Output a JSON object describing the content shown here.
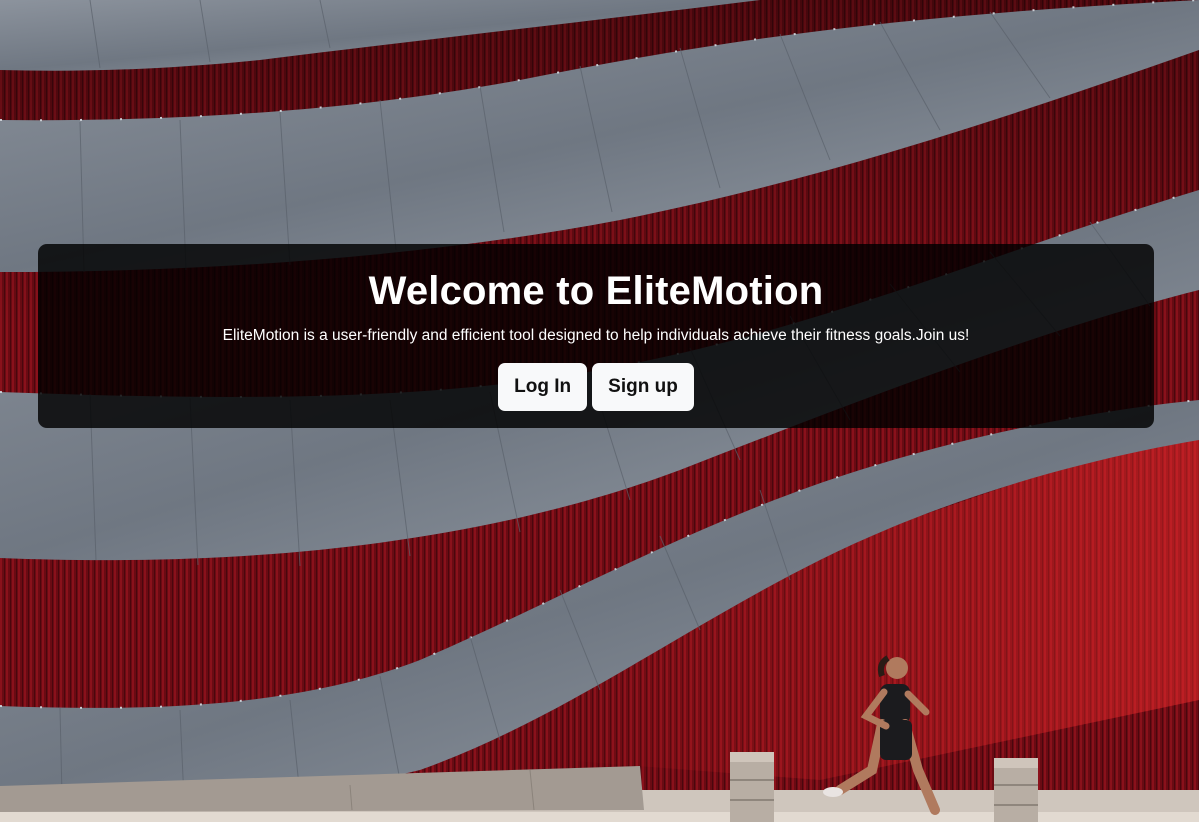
{
  "hero": {
    "title": "Welcome to EliteMotion",
    "subtitle": "EliteMotion is a user-friendly and efficient tool designed to help individuals achieve their fitness goals.Join us!",
    "login_label": "Log In",
    "signup_label": "Sign up"
  },
  "colors": {
    "wall_red": "#7a0c14",
    "panel_gray": "#6e7580",
    "overlay": "#000000",
    "button_bg": "#f8f9fa"
  }
}
